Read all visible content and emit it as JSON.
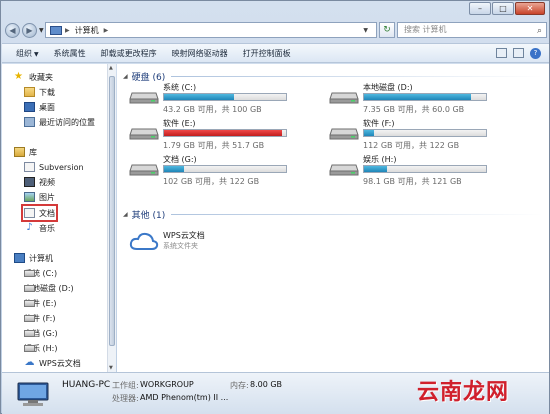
{
  "address": {
    "crumbs": [
      "计算机"
    ],
    "search_placeholder": "搜索 计算机"
  },
  "toolbar": {
    "items": [
      "组织",
      "系统属性",
      "卸载或更改程序",
      "映射网络驱动器",
      "打开控制面板"
    ]
  },
  "nav": {
    "favorites": {
      "label": "收藏夹",
      "items": [
        "下载",
        "桌面",
        "最近访问的位置"
      ]
    },
    "libraries": {
      "label": "库",
      "items": [
        "Subversion",
        "视频",
        "图片",
        "文档",
        "音乐"
      ]
    },
    "computer": {
      "label": "计算机",
      "items": [
        "系统 (C:)",
        "本地磁盘 (D:)",
        "软件 (E:)",
        "软件 (F:)",
        "文档 (G:)",
        "娱乐 (H:)",
        "WPS云文档"
      ]
    }
  },
  "content": {
    "hard_disks": {
      "title": "硬盘 (6)",
      "drives": [
        {
          "name": "系统 (C:)",
          "info": "43.2 GB 可用，共 100 GB",
          "used": 0.57
        },
        {
          "name": "本地磁盘 (D:)",
          "info": "7.35 GB 可用，共 60.0 GB",
          "used": 0.88
        },
        {
          "name": "软件 (E:)",
          "info": "1.79 GB 可用，共 51.7 GB",
          "used": 0.97
        },
        {
          "name": "软件 (F:)",
          "info": "112 GB 可用，共 122 GB",
          "used": 0.08
        },
        {
          "name": "文档 (G:)",
          "info": "102 GB 可用，共 122 GB",
          "used": 0.16
        },
        {
          "name": "娱乐 (H:)",
          "info": "98.1 GB 可用，共 121 GB",
          "used": 0.19
        }
      ]
    },
    "other": {
      "title": "其他 (1)",
      "wps_name": "WPS云文档",
      "wps_sub": "系统文件夹"
    }
  },
  "details": {
    "host": "HUANG-PC",
    "workgroup_label": "工作组:",
    "workgroup": "WORKGROUP",
    "memory_label": "内存:",
    "memory": "8.00 GB",
    "cpu_label": "处理器:",
    "cpu": "AMD Phenom(tm) II ..."
  },
  "watermark": "云南龙网",
  "colors": {
    "bar_normal": "#26a0da",
    "bar_full": "#da2626"
  }
}
